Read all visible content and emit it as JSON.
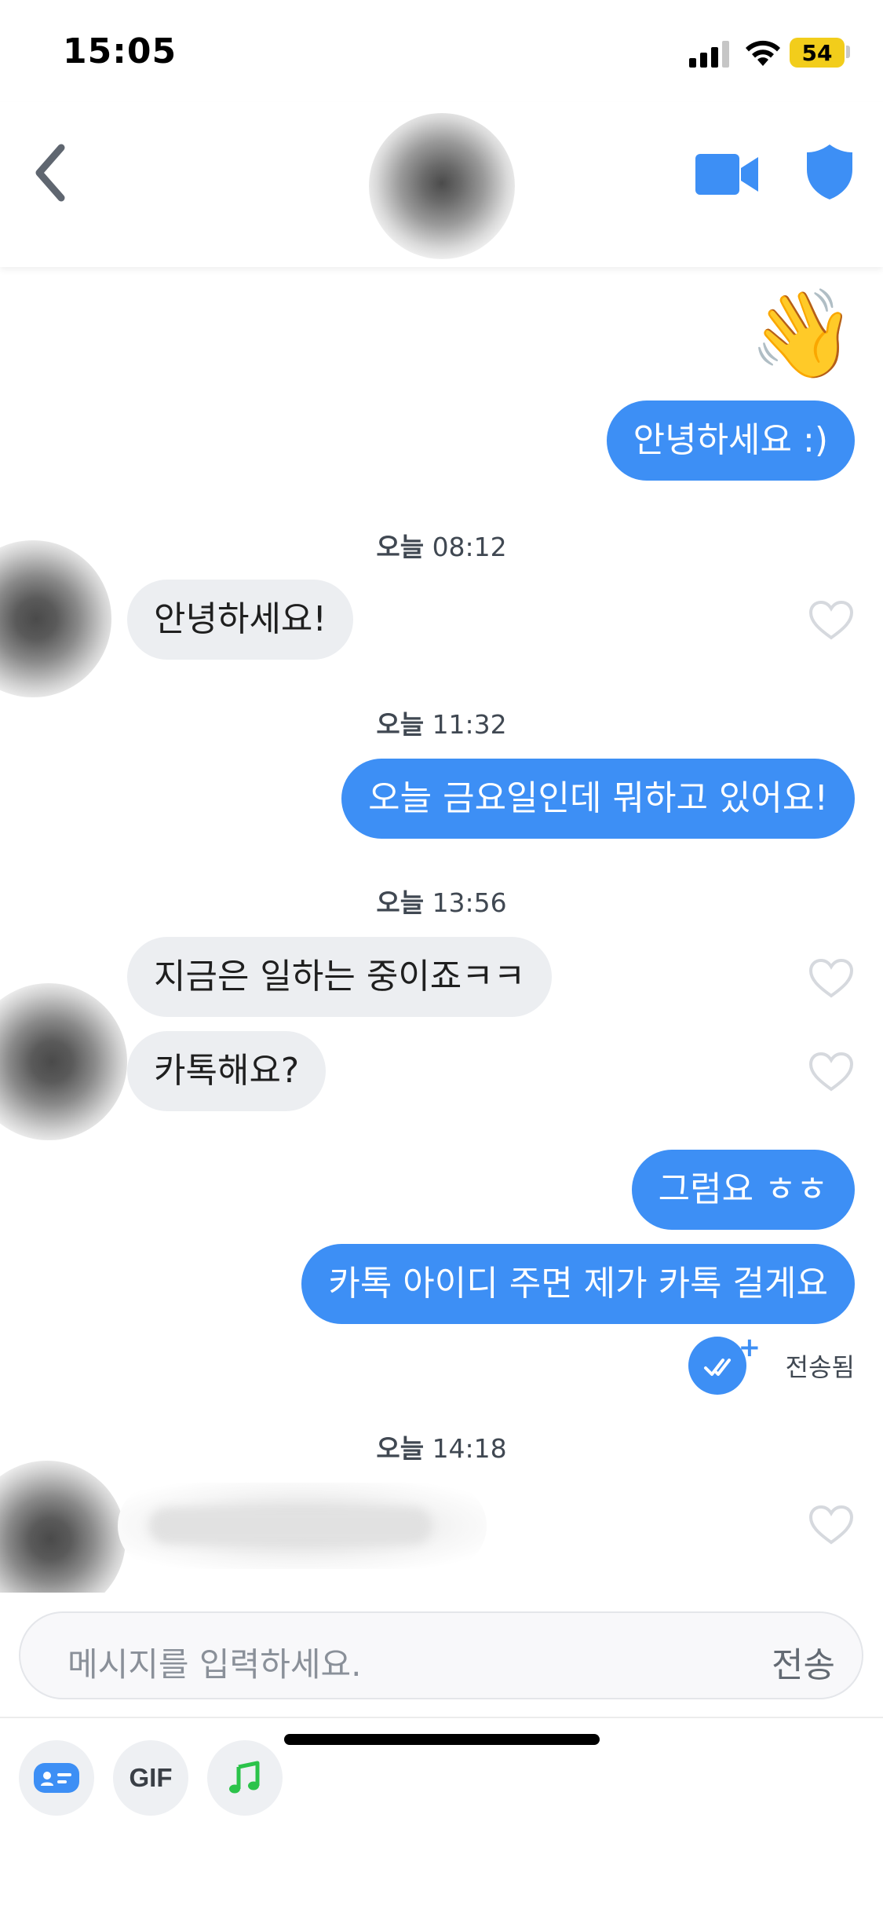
{
  "status_bar": {
    "time": "15:05",
    "battery": "54"
  },
  "header": {
    "back": "back",
    "video": "video-call",
    "safety": "safety-shield"
  },
  "messages": {
    "wave": "👋",
    "m1": "안녕하세요 :)",
    "ts1_day": "오늘",
    "ts1_time": "08:12",
    "m2": "안녕하세요!",
    "ts2_day": "오늘",
    "ts2_time": "11:32",
    "m3": "오늘 금요일인데 뭐하고 있어요!",
    "ts3_day": "오늘",
    "ts3_time": "13:56",
    "m4": "지금은 일하는 중이죠ㅋㅋ",
    "m5": "카톡해요?",
    "m6": "그럼요 ㅎㅎ",
    "m7": "카톡 아이디 주면 제가 카톡 걸게요",
    "sent_status": "전송됨",
    "ts4_day": "오늘",
    "ts4_time": "14:18"
  },
  "input": {
    "placeholder": "메시지를 입력하세요.",
    "send_label": "전송"
  },
  "toolbar": {
    "gif_label": "GIF"
  },
  "colors": {
    "accent": "#3d8ff5",
    "incoming_bubble": "#eceef1",
    "battery": "#f2cd1b",
    "music": "#2bc34a"
  }
}
